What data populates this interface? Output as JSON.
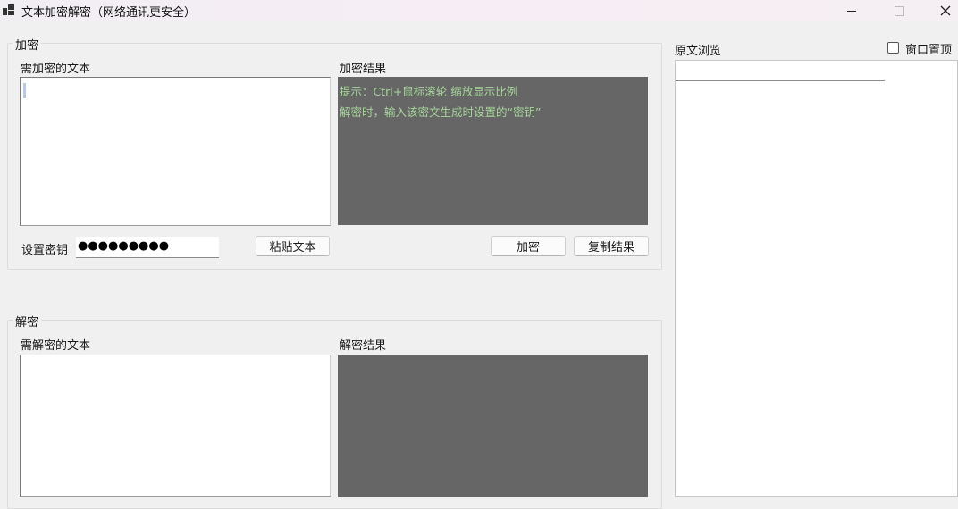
{
  "window": {
    "title": "文本加密解密（网络通讯更安全）",
    "icon": "app-windows-icon"
  },
  "encrypt": {
    "group_title": "加密",
    "input_label": "需加密的文本",
    "input_value": "",
    "result_label": "加密结果",
    "hints": [
      "提示：Ctrl+鼠标滚轮 缩放显示比例",
      "解密时，输入该密文生成时设置的“密钥”"
    ],
    "key_label": "设置密钥",
    "key_masked": "●●●●●●●●●",
    "paste_button": "粘贴文本",
    "encrypt_button": "加密",
    "copy_button": "复制结果"
  },
  "decrypt": {
    "group_title": "解密",
    "input_label": "需解密的文本",
    "input_value": "",
    "result_label": "解密结果"
  },
  "preview": {
    "label": "原文浏览",
    "topmost_label": "窗口置顶",
    "topmost_checked": false
  },
  "colors": {
    "result_bg": "#666666",
    "hint_text": "#a6d59a",
    "window_bg": "#f0f0f0"
  }
}
